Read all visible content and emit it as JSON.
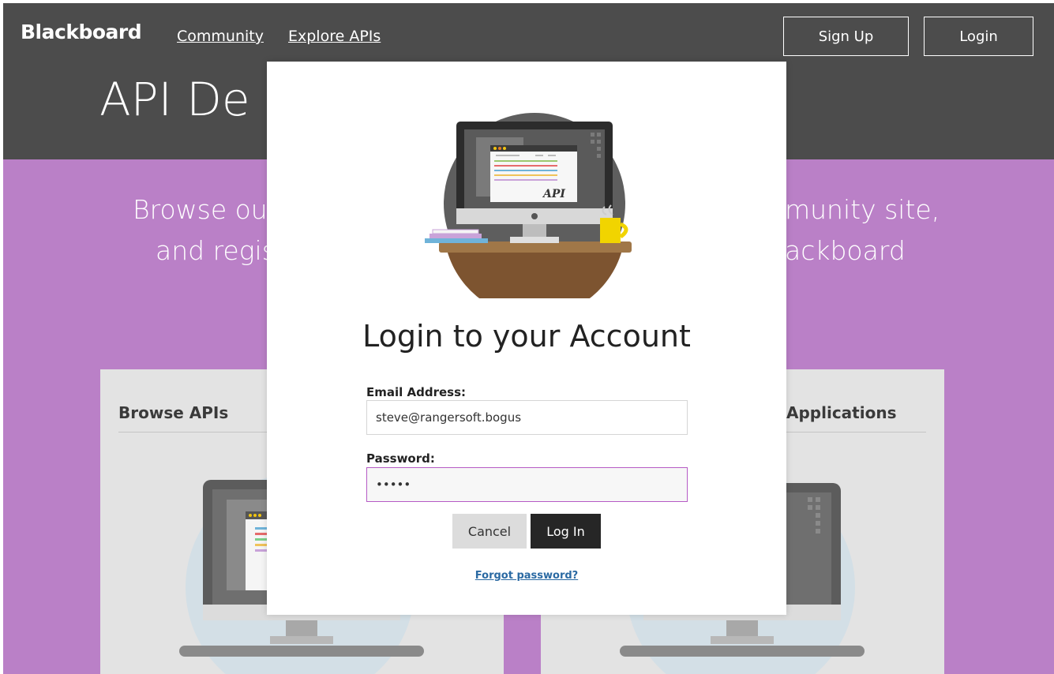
{
  "header": {
    "brand": "Blackboard",
    "nav": [
      "Community",
      "Explore APIs"
    ],
    "signup_label": "Sign Up",
    "login_label": "Login"
  },
  "hero": {
    "title": "API De"
  },
  "band": {
    "line1_left": "Browse our",
    "line1_right": "munity site,",
    "line2_left": "and regis",
    "line2_right": "ackboard"
  },
  "cards": {
    "left_title": "Browse APIs",
    "right_title": "Applications"
  },
  "modal": {
    "illustration_label": "API",
    "title": "Login to your Account",
    "email_label": "Email Address:",
    "email_value": "steve@rangersoft.bogus",
    "password_label": "Password:",
    "password_mask": "•••••",
    "cancel_label": "Cancel",
    "login_label": "Log In",
    "forgot_label": "Forgot password?"
  },
  "colors": {
    "header_bg": "#4c4c4c",
    "band_bg": "#ba80c7",
    "focus_border": "#b65bc5",
    "link": "#2b6aa3"
  }
}
